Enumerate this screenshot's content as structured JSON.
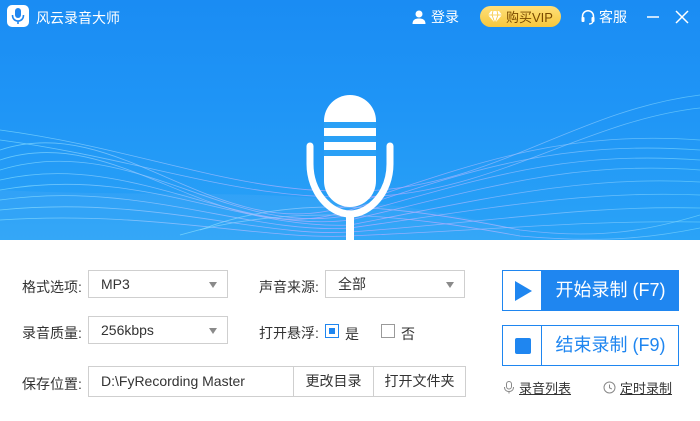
{
  "app": {
    "title": "风云录音大师"
  },
  "header": {
    "login_label": "登录",
    "vip_label": "购买VIP",
    "service_label": "客服"
  },
  "form": {
    "format_label": "格式选项:",
    "format_value": "MP3",
    "source_label": "声音来源:",
    "source_value": "全部",
    "quality_label": "录音质量:",
    "quality_value": "256kbps",
    "float_label": "打开悬浮:",
    "float_yes_label": "是",
    "float_no_label": "否",
    "float_yes_checked": true,
    "save_label": "保存位置:",
    "save_path": "D:\\FyRecording Master",
    "change_dir_label": "更改目录",
    "open_folder_label": "打开文件夹"
  },
  "actions": {
    "start_label": "开始录制 (F7)",
    "stop_label": "结束录制 (F9)",
    "list_label": "录音列表",
    "timer_label": "定时录制"
  },
  "colors": {
    "accent": "#1f86f0",
    "banner": "#1f95f6",
    "vip": "#f7c73c"
  }
}
